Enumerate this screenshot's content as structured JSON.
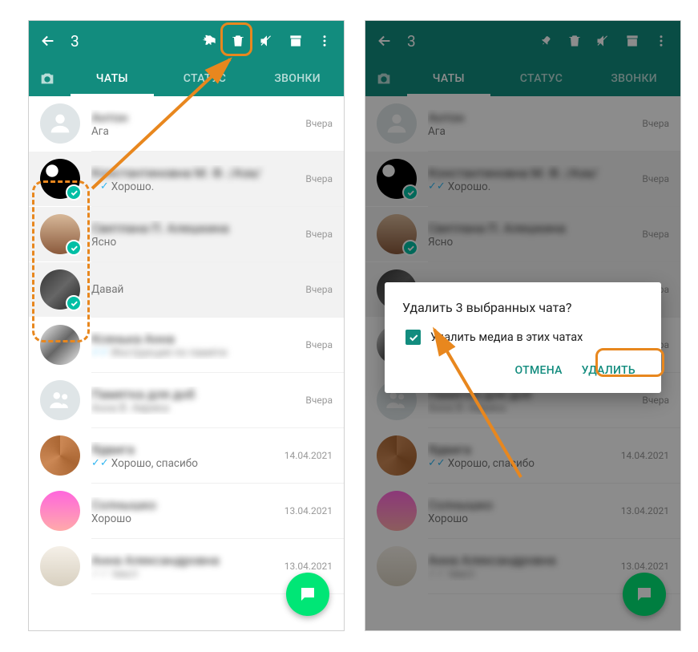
{
  "header": {
    "count": "3"
  },
  "tabs": {
    "chats": "ЧАТЫ",
    "status": "СТАТУС",
    "calls": "ЗВОНКИ"
  },
  "chats": [
    {
      "name": "Антон",
      "msg": "Ага",
      "time": "Вчера",
      "selected": false,
      "ticks": "",
      "avatar": "default"
    },
    {
      "name": "Константиновна М. Ф. /Аза/",
      "msg": "Хорошо.",
      "time": "Вчера",
      "selected": true,
      "ticks": "blue",
      "avatar": "girl"
    },
    {
      "name": "Светлана П. Алешкина",
      "msg": "Ясно",
      "time": "Вчера",
      "selected": true,
      "ticks": "",
      "avatar": "brown"
    },
    {
      "name": "Давай",
      "msg": "Давай",
      "time": "Вчера",
      "selected": true,
      "ticks": "",
      "avatar": "dark",
      "msgonly": true
    },
    {
      "name": "Ксенька Анна",
      "msg": "Инструкция по памяти",
      "time": "Вчера",
      "selected": false,
      "ticks": "blue",
      "avatar": "bw",
      "blurmsg": true
    },
    {
      "name": "Памятка для доб",
      "msg": "Анна В. Аврика",
      "time": "Вчера",
      "selected": false,
      "ticks": "",
      "avatar": "group",
      "blurmsg": true
    },
    {
      "name": "Ядвига",
      "msg": "Хорошо, спасибо",
      "time": "14.04.2021",
      "selected": false,
      "ticks": "blue",
      "avatar": "swirl"
    },
    {
      "name": "Солнышко",
      "msg": "Хорошо",
      "time": "13.04.2021",
      "selected": false,
      "ticks": "",
      "avatar": "pink"
    },
    {
      "name": "Анна Александровна",
      "msg": "текст",
      "time": "13.04.2021",
      "selected": false,
      "ticks": "grey",
      "avatar": "pale",
      "blurmsg": true
    }
  ],
  "dialog": {
    "title": "Удалить 3 выбранных чата?",
    "checkbox": "Удалить медиа в этих чатах",
    "cancel": "ОТМЕНА",
    "delete": "УДАЛИТЬ"
  }
}
